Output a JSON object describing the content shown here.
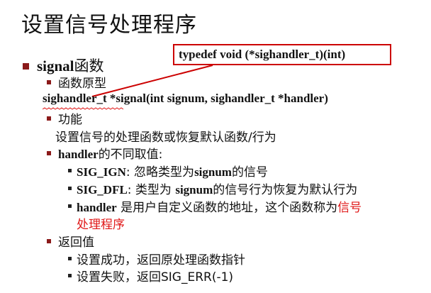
{
  "title": "设置信号处理程序",
  "callout": "typedef void (*sighandler_t)(int)",
  "signal_heading": {
    "a": "signal",
    "b": "函数"
  },
  "prototype_label": "函数原型",
  "prototype": "sighandler_t *signal(int signum, sighandler_t *handler)",
  "function_label": "功能",
  "function_desc": "设置信号的处理函数或恢复默认函数/行为",
  "handler_heading": {
    "a": "handler",
    "b": "的不同取值:"
  },
  "handler_items": [
    {
      "code": "SIG_IGN",
      "text1": ": 忽略类型为",
      "code2": "signum",
      "text2": "的信号"
    },
    {
      "code": "SIG_DFL",
      "text1": ": 类型为 ",
      "code2": "signum",
      "text2": "的信号行为恢复为默认行为"
    },
    {
      "code": "handler",
      "text1": " 是用户自定义函数的地址，这个函数称为",
      "red1": "信号",
      "red2": "处理程序"
    }
  ],
  "return_label": "返回值",
  "return_items": [
    "设置成功，返回原处理函数指针",
    "设置失败，返回SIG_ERR(-1)"
  ],
  "colors": {
    "bullet": "#8b1a1a",
    "highlight": "#e01818",
    "callout_border": "#cc0000"
  }
}
